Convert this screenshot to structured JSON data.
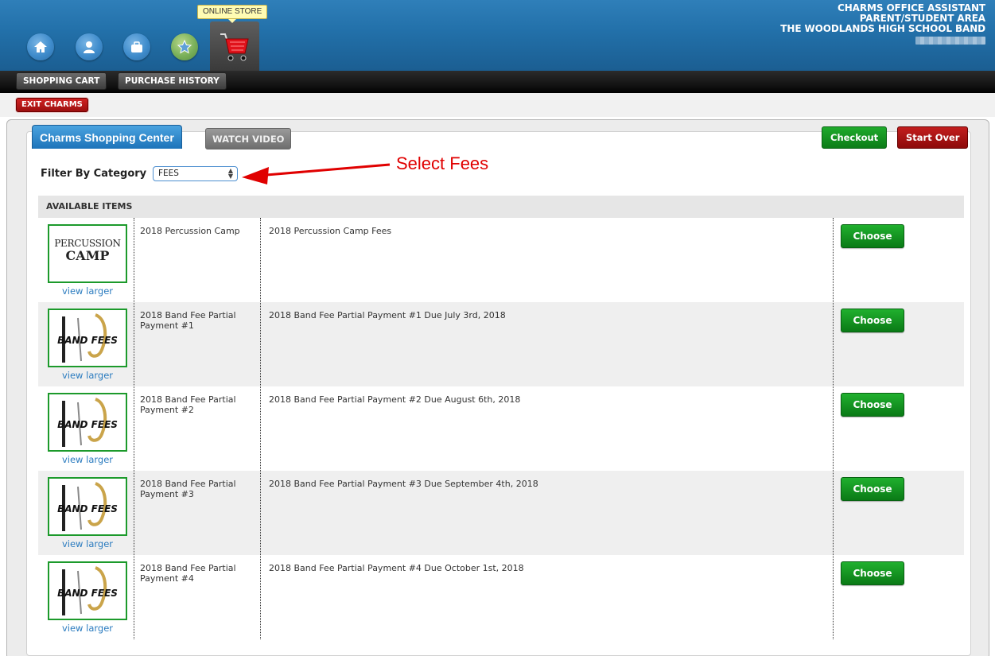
{
  "header": {
    "line1": "CHARMS OFFICE ASSISTANT",
    "line2": "PARENT/STUDENT AREA",
    "line3": "THE WOODLANDS HIGH SCHOOL BAND",
    "tooltip": "ONLINE STORE"
  },
  "nav_icons": [
    "home-icon",
    "person-icon",
    "briefcase-icon",
    "star-icon",
    "cart-icon"
  ],
  "subnav": {
    "cart": "SHOPPING CART",
    "history": "PURCHASE HISTORY"
  },
  "exit": "EXIT CHARMS",
  "panel": {
    "title": "Charms Shopping Center",
    "video": "WATCH VIDEO",
    "checkout": "Checkout",
    "start_over": "Start Over"
  },
  "filter": {
    "label": "Filter By Category",
    "value": "FEES"
  },
  "annotation": "Select Fees",
  "available": "AVAILABLE ITEMS",
  "thumb_text": {
    "camp_line1": "PERCUSSION",
    "camp_line2": "CAMP",
    "band": "BAND FEES"
  },
  "items": [
    {
      "name": "2018 Percussion Camp",
      "desc": "2018 Percussion Camp Fees",
      "view": "view larger",
      "action": "Choose"
    },
    {
      "name": "2018 Band Fee Partial Payment #1",
      "desc": "2018 Band Fee Partial Payment #1 Due July 3rd, 2018",
      "view": "view larger",
      "action": "Choose"
    },
    {
      "name": "2018 Band Fee Partial Payment #2",
      "desc": "2018 Band Fee Partial Payment #2 Due August 6th, 2018",
      "view": "view larger",
      "action": "Choose"
    },
    {
      "name": "2018 Band Fee Partial Payment #3",
      "desc": "2018 Band Fee Partial Payment #3 Due September 4th, 2018",
      "view": "view larger",
      "action": "Choose"
    },
    {
      "name": "2018 Band Fee Partial Payment #4",
      "desc": "2018 Band Fee Partial Payment #4 Due October 1st, 2018",
      "view": "view larger",
      "action": "Choose"
    }
  ]
}
